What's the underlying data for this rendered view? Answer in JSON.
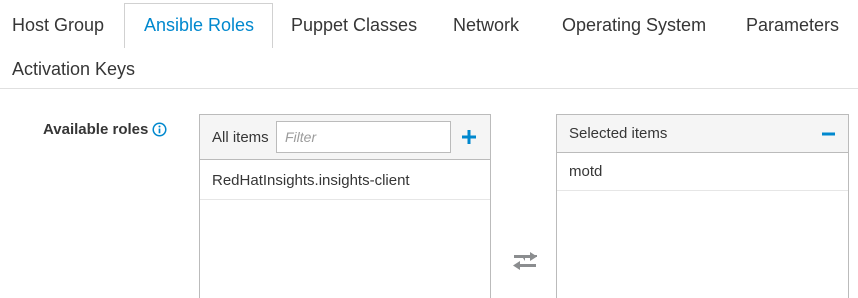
{
  "tabs": [
    {
      "label": "Host Group",
      "active": false
    },
    {
      "label": "Ansible Roles",
      "active": true
    },
    {
      "label": "Puppet Classes",
      "active": false
    },
    {
      "label": "Network",
      "active": false
    },
    {
      "label": "Operating System",
      "active": false
    },
    {
      "label": "Parameters",
      "active": false
    },
    {
      "label": "Activation Keys",
      "active": false
    }
  ],
  "form": {
    "available_roles_label": "Available roles",
    "info_icon": "info-circle-icon"
  },
  "available": {
    "header": "All items",
    "filter_placeholder": "Filter",
    "add_icon": "plus-icon",
    "items": [
      "RedHatInsights.insights-client"
    ]
  },
  "selected": {
    "header": "Selected items",
    "remove_icon": "minus-icon",
    "items": [
      "motd"
    ]
  },
  "colors": {
    "accent": "#0088ce",
    "text": "#363636",
    "icon_gray": "#8b8d8f"
  }
}
